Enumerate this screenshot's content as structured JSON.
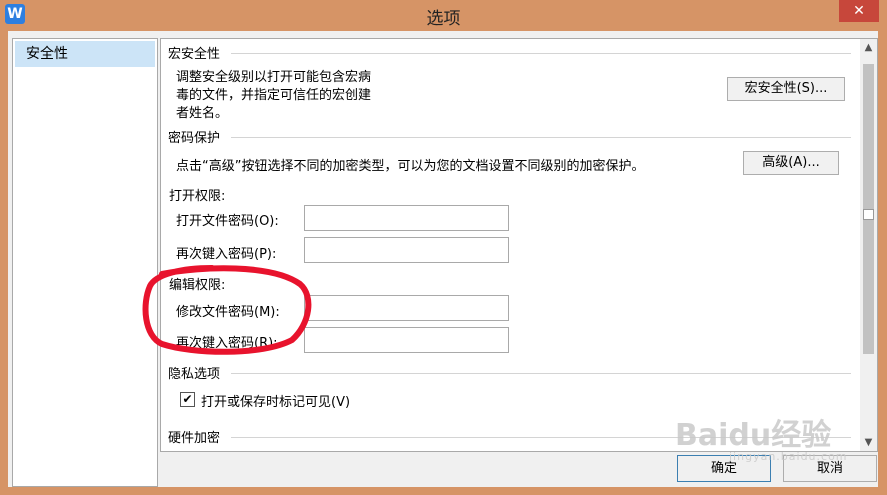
{
  "window": {
    "title": "选项",
    "close_glyph": "✕",
    "app_icon_letter": "W"
  },
  "nav": {
    "items": [
      {
        "label": "安全性"
      }
    ]
  },
  "macro_security": {
    "heading": "宏安全性",
    "desc_line1": "调整安全级别以打开可能包含宏病",
    "desc_line2": "毒的文件，并指定可信任的宏创建",
    "desc_line3": "者姓名。",
    "button": "宏安全性(S)..."
  },
  "password": {
    "heading": "密码保护",
    "desc": "点击“高级”按钮选择不同的加密类型，可以为您的文档设置不同级别的加密保护。",
    "advanced_button": "高级(A)...",
    "open_perm": {
      "heading": "打开权限:",
      "open_label": "打开文件密码(O):",
      "open_value": "",
      "reenter_label": "再次键入密码(P):",
      "reenter_value": ""
    },
    "edit_perm": {
      "heading": "编辑权限:",
      "modify_label": "修改文件密码(M):",
      "modify_value": "",
      "reenter_label": "再次键入密码(R):",
      "reenter_value": ""
    }
  },
  "privacy": {
    "heading": "隐私选项",
    "checkbox_label": "打开或保存时标记可见(V)",
    "checked": true
  },
  "hardware": {
    "heading": "硬件加密"
  },
  "footer": {
    "ok": "确定",
    "cancel": "取消"
  },
  "watermark": {
    "text": "Baidu经验",
    "sub": "jingyan.baidu.com"
  },
  "colors": {
    "title_bar": "#d69466",
    "close": "#c7473b",
    "selection": "#cce4f7",
    "annotation": "#e8132d"
  }
}
